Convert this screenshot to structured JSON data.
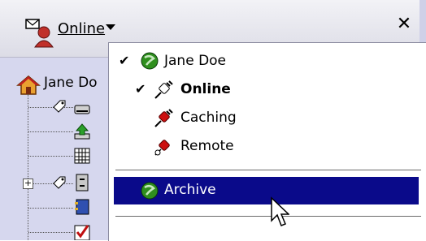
{
  "header": {
    "status_label": "Online",
    "close_label": "✕",
    "status_icon": "user-status-icon"
  },
  "tree": {
    "root_label": "Jane Do",
    "expander_label": "+",
    "nodes": [
      {
        "icon": "drive-icon"
      },
      {
        "icon": "upload-icon"
      },
      {
        "icon": "calendar-icon"
      },
      {
        "icon": "cabinet-icon"
      },
      {
        "icon": "address-book-icon"
      },
      {
        "icon": "tasks-icon"
      }
    ]
  },
  "menu": {
    "items": [
      {
        "label": "Jane Doe",
        "checked": true,
        "icon": "groupwise-globe-icon"
      },
      {
        "label": "Online",
        "checked": true,
        "bold": true,
        "icon": "plug-icon"
      },
      {
        "label": "Caching",
        "checked": false,
        "icon": "plug-icon"
      },
      {
        "label": "Remote",
        "checked": false,
        "icon": "plug-icon"
      },
      {
        "label": "Archive",
        "checked": false,
        "highlighted": true,
        "icon": "groupwise-globe-icon"
      }
    ],
    "check_glyph": "✔"
  },
  "colors": {
    "tree_background": "#d6d7ee",
    "highlight": "#0a0a8a",
    "plug_red": "#cc1010",
    "globe_green": "#2f8f1e"
  }
}
